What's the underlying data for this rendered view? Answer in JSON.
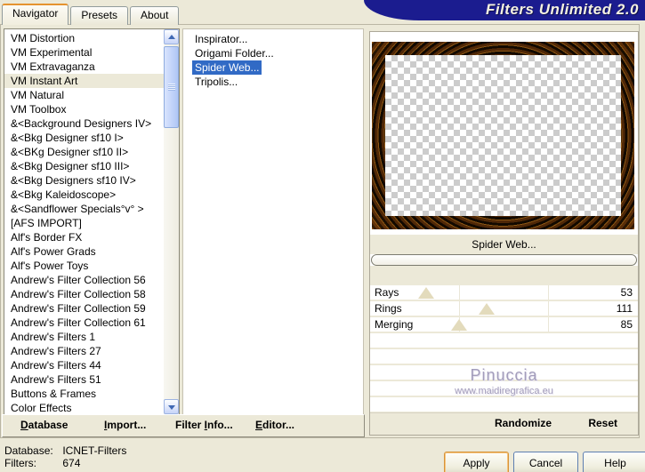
{
  "banner": {
    "title": "Filters Unlimited 2.0"
  },
  "tabs": [
    {
      "label": "Navigator",
      "active": true
    },
    {
      "label": "Presets",
      "active": false
    },
    {
      "label": "About",
      "active": false
    }
  ],
  "category_list": {
    "selected_index": 3,
    "items": [
      "VM Distortion",
      "VM Experimental",
      "VM Extravaganza",
      "VM Instant Art",
      "VM Natural",
      "VM Toolbox",
      "&<Background Designers IV>",
      "&<Bkg Designer sf10 I>",
      "&<BKg Designer sf10 II>",
      "&<Bkg Designer sf10 III>",
      "&<Bkg Designers sf10 IV>",
      "&<Bkg Kaleidoscope>",
      "&<Sandflower Specials°v° >",
      "[AFS IMPORT]",
      "Alf's Border FX",
      "Alf's Power Grads",
      "Alf's Power Toys",
      "Andrew's Filter Collection 56",
      "Andrew's Filter Collection 58",
      "Andrew's Filter Collection 59",
      "Andrew's Filter Collection 61",
      "Andrew's Filters 1",
      "Andrew's Filters 27",
      "Andrew's Filters 44",
      "Andrew's Filters 51",
      "Buttons & Frames",
      "Color Effects"
    ]
  },
  "filter_list": {
    "selected_index": 2,
    "items": [
      "Inspirator...",
      "Origami Folder...",
      "Spider Web...",
      "Tripolis..."
    ]
  },
  "controls": {
    "filter_title": "Spider Web...",
    "progress_value": 0,
    "slider_max": 255,
    "sliders": [
      {
        "label": "Rays",
        "value": 53
      },
      {
        "label": "Rings",
        "value": 111
      },
      {
        "label": "Merging",
        "value": 85
      }
    ],
    "empty_rows": 5,
    "watermark": {
      "name": "Pinuccia",
      "url": "www.maidiregrafica.eu"
    }
  },
  "toolbar": {
    "buttons": [
      {
        "label": "Database",
        "accel_index": 0
      },
      {
        "label": "Import...",
        "accel_index": 0
      },
      {
        "label": "Filter Info...",
        "accel_index": 7
      },
      {
        "label": "Editor...",
        "accel_index": 0
      }
    ]
  },
  "panel_toolbar": {
    "randomize_label": "Randomize",
    "reset_label": "Reset"
  },
  "status": {
    "database_label": "Database:",
    "database_value": "ICNET-Filters",
    "filters_label": "Filters:",
    "filters_value": "674"
  },
  "dialog_buttons": [
    {
      "label": "Apply",
      "default": true
    },
    {
      "label": "Cancel",
      "default": false
    },
    {
      "label": "Help",
      "default": false
    }
  ],
  "colors": {
    "dialog_bg": "#ECE9D8",
    "banner_bg": "#1B1C8F",
    "selection_blue": "#316AC5",
    "tab_accent_orange": "#E5932F"
  }
}
